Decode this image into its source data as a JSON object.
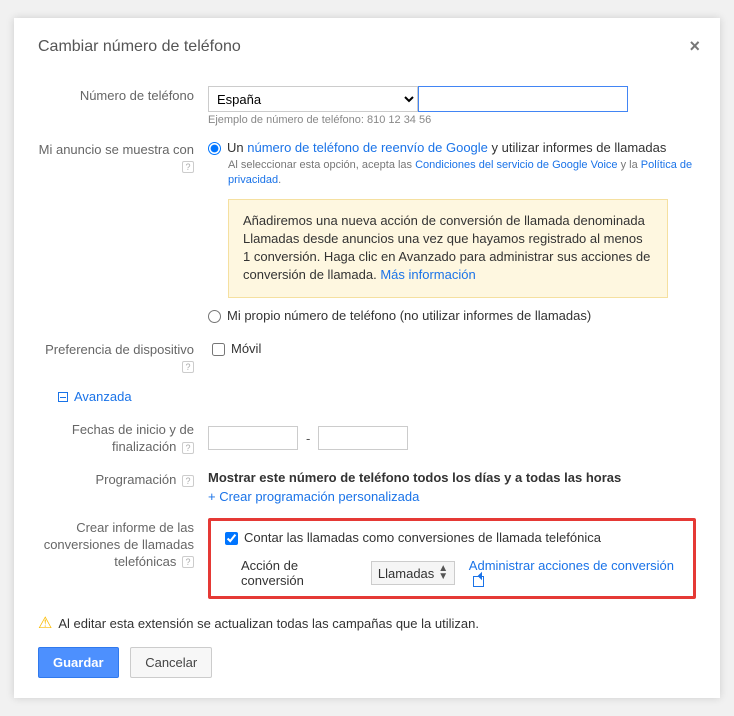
{
  "title": "Cambiar número de teléfono",
  "phone": {
    "label": "Número de teléfono",
    "country": "España",
    "value": "",
    "example": "Ejemplo de número de teléfono: 810 12 34 56"
  },
  "showWith": {
    "label": "Mi anuncio se muestra con",
    "opt1_prefix": "Un ",
    "opt1_link": "número de teléfono de reenvío de Google",
    "opt1_suffix": " y utilizar informes de llamadas",
    "fine_prefix": "Al seleccionar esta opción, acepta las ",
    "fine_link1": "Condiciones del servicio de Google Voice",
    "fine_mid": " y la ",
    "fine_link2": "Política de privacidad",
    "fine_end": ".",
    "info_text": "Añadiremos una nueva acción de conversión de llamada denominada Llamadas desde anuncios una vez que hayamos registrado al menos 1 conversión. Haga clic en Avanzado para administrar sus acciones de conversión de llamada. ",
    "info_link": "Más información",
    "opt2": "Mi propio número de teléfono (no utilizar informes de llamadas)"
  },
  "device": {
    "label": "Preferencia de dispositivo",
    "option": "Móvil"
  },
  "advanced_label": "Avanzada",
  "dates": {
    "label": "Fechas de inicio y de finalización"
  },
  "schedule": {
    "label": "Programación",
    "text": "Mostrar este número de teléfono todos los días y a todas las horas",
    "create_link": "+ Crear programación personalizada"
  },
  "report": {
    "label": "Crear informe de las conversiones de llamadas telefónicas",
    "cb_label": "Contar las llamadas como conversiones de llamada telefónica",
    "action_label": "Acción de conversión",
    "action_value": "Llamadas",
    "manage_link": "Administrar acciones de conversión"
  },
  "warning": "Al editar esta extensión se actualizan todas las campañas que la utilizan.",
  "buttons": {
    "save": "Guardar",
    "cancel": "Cancelar"
  }
}
